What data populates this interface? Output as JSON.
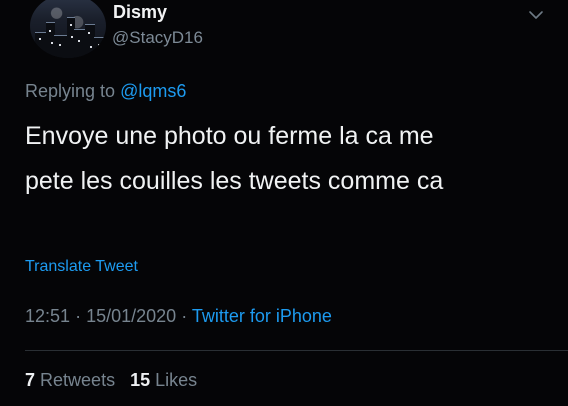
{
  "user": {
    "display_name": "Dismy",
    "handle": "@StacyD16"
  },
  "reply": {
    "prefix": "Replying to",
    "mention": "@lqms6"
  },
  "tweet": {
    "line1": "Envoye une photo ou ferme la ca me",
    "line2": "pete les couilles les tweets comme ca"
  },
  "translate_label": "Translate Tweet",
  "meta": {
    "time": "12:51",
    "date": "15/01/2020",
    "separator": "·",
    "source": "Twitter for iPhone"
  },
  "stats": {
    "retweets_count": "7",
    "retweets_label": "Retweets",
    "likes_count": "15",
    "likes_label": "Likes"
  },
  "icons": {
    "avatar": "profile-avatar-image",
    "menu": "chevron-down-icon"
  },
  "colors": {
    "background": "#050507",
    "accent": "#1d9bf0",
    "muted_text": "#77848f"
  }
}
